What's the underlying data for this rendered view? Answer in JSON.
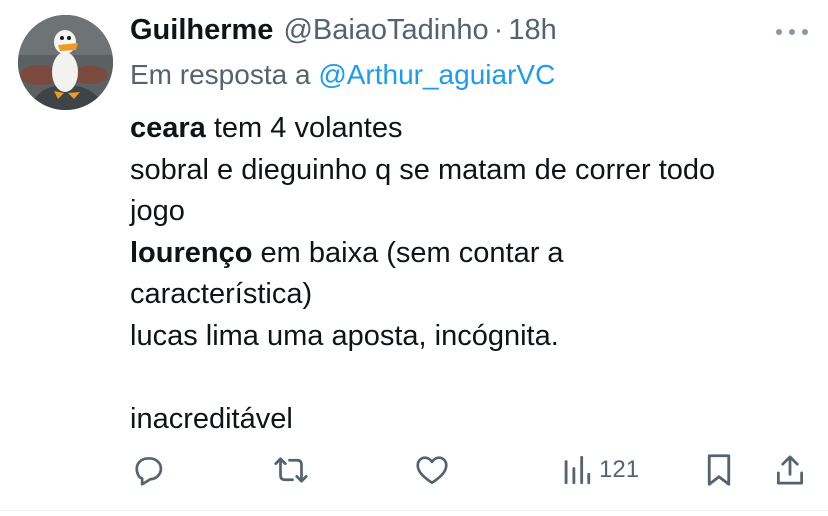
{
  "tweet": {
    "author": {
      "name": "Guilherme",
      "handle": "@BaiaoTadinho",
      "separator": "·",
      "time": "18h"
    },
    "reply": {
      "prefix": "Em resposta a ",
      "mention": "@Arthur_aguiarVC"
    },
    "body": {
      "line1_bold": "ceara",
      "line1_rest": " tem 4 volantes",
      "line2": "sobral e dieguinho q se matam de correr todo",
      "line3": "jogo",
      "line4_bold": "lourenço",
      "line4_rest": " em baixa (sem contar a",
      "line5": "característica)",
      "line6": "lucas lima uma aposta, incógnita.",
      "line8": "inacreditável"
    },
    "stats": {
      "views": "121"
    },
    "icons": {
      "more": "more-dots-icon",
      "reply": "reply-bubble-icon",
      "retweet": "retweet-icon",
      "like": "heart-icon",
      "views": "bar-chart-icon",
      "bookmark": "bookmark-icon",
      "share": "share-upload-icon"
    },
    "colors": {
      "text": "#0f1419",
      "muted": "#536471",
      "link": "#1d9bf0",
      "icon": "#536471"
    }
  }
}
